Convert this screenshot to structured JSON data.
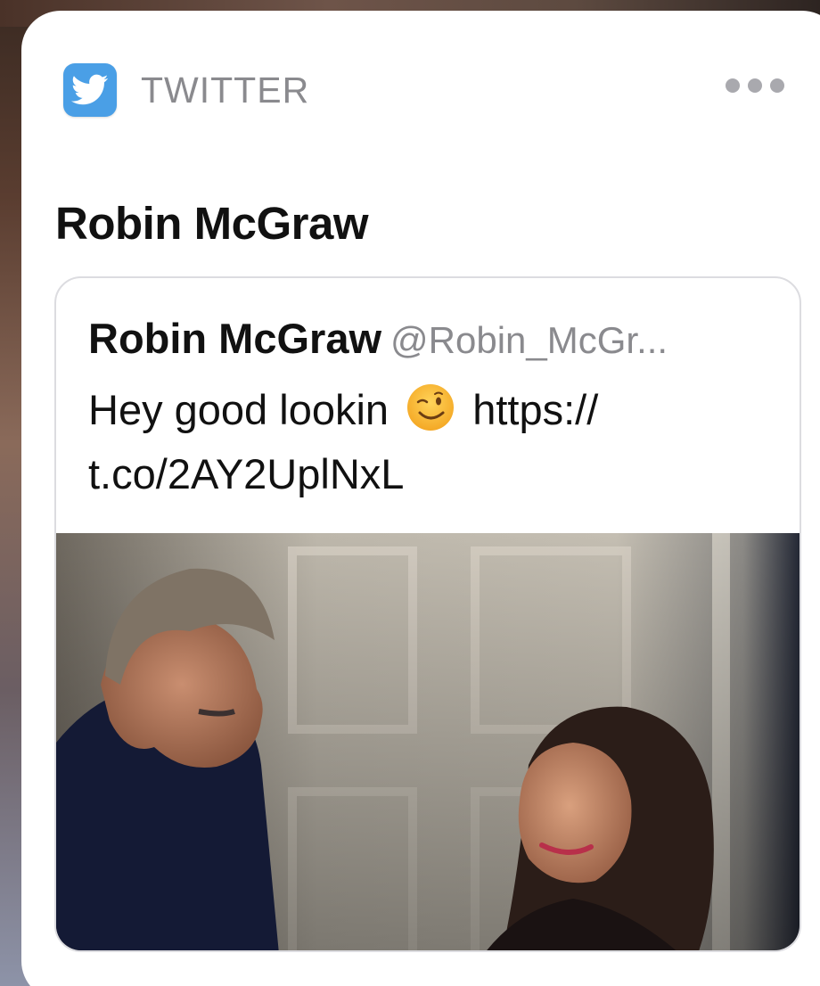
{
  "notification": {
    "app_icon": "twitter-bird-icon",
    "app_name": "TWITTER",
    "more_icon": "more-dots-icon",
    "title": "Robin McGraw",
    "tweet": {
      "author_name": "Robin McGraw",
      "handle": "@Robin_McGr...",
      "text_before_emoji": "Hey good lookin",
      "emoji": "winking-face-emoji",
      "link_line1": "https://",
      "link_line2": "t.co/2AY2UplNxL",
      "photo": "tweet-photo-image"
    }
  },
  "colors": {
    "twitter_blue": "#4a9fe6",
    "secondary_text": "#8a8a8e",
    "primary_text": "#111111"
  }
}
